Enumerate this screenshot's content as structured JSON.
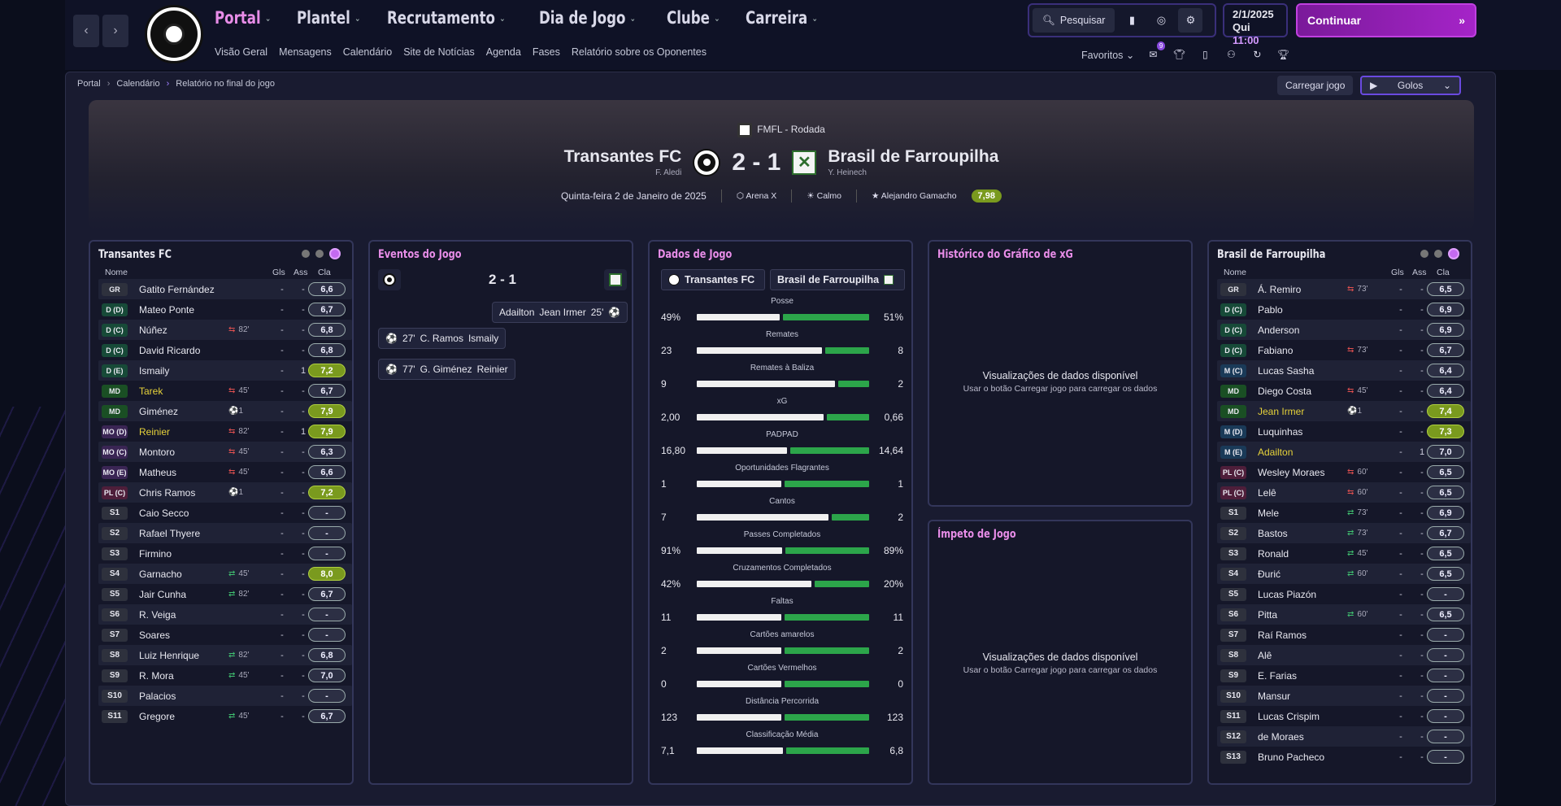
{
  "nav": {
    "main": [
      {
        "label": "Portal",
        "active": true
      },
      {
        "label": "Plantel",
        "active": false
      },
      {
        "label": "Recrutamento",
        "active": false
      },
      {
        "label": "Dia de Jogo",
        "active": false
      },
      {
        "label": "Clube",
        "active": false
      },
      {
        "label": "Carreira",
        "active": false
      }
    ],
    "sub": [
      "Visão Geral",
      "Mensagens",
      "Calendário",
      "Site de Notícias",
      "Agenda",
      "Fases",
      "Relatório sobre os Oponentes"
    ],
    "search_label": "Pesquisar",
    "date": "2/1/2025",
    "weekday": "Qui",
    "time": "11:00",
    "continue_label": "Continuar",
    "favorites_label": "Favoritos",
    "msg_badge": "9"
  },
  "breadcrumb": [
    "Portal",
    "Calendário",
    "Relatório no final do jogo"
  ],
  "actions": {
    "load_game": "Carregar jogo",
    "highlights": "Golos"
  },
  "match": {
    "competition": "FMFL - Rodada",
    "home": "Transantes FC",
    "home_manager": "F. Aledi",
    "away": "Brasil de Farroupilha",
    "away_manager": "Y. Heinech",
    "score": "2 - 1",
    "date": "Quinta-feira 2 de Janeiro de 2025",
    "stadium": "Arena X",
    "weather": "Calmo",
    "referee": "Alejandro Gamacho",
    "referee_rating": "7,98"
  },
  "home_panel": {
    "title": "Transantes FC",
    "headers": {
      "name": "Nome",
      "goals": "Gls",
      "assists": "Ass",
      "rating": "Cla"
    },
    "players": [
      {
        "pos": "GR",
        "cls": "gk",
        "name": "Gatito Fernández",
        "sub": "",
        "gl": "-",
        "as": "-",
        "cl": "6,6",
        "hi": false
      },
      {
        "pos": "D (D)",
        "cls": "d",
        "name": "Mateo Ponte",
        "sub": "",
        "gl": "-",
        "as": "-",
        "cl": "6,7",
        "hi": false
      },
      {
        "pos": "D (C)",
        "cls": "d",
        "name": "Núñez",
        "sub": "82'",
        "subdir": "out",
        "gl": "-",
        "as": "-",
        "cl": "6,8",
        "hi": false
      },
      {
        "pos": "D (C)",
        "cls": "d",
        "name": "David Ricardo",
        "sub": "",
        "gl": "-",
        "as": "-",
        "cl": "6,8",
        "hi": false
      },
      {
        "pos": "D (E)",
        "cls": "d",
        "name": "Ismaily",
        "sub": "",
        "gl": "-",
        "as": "1",
        "cl": "7,2",
        "hi": true
      },
      {
        "pos": "MD",
        "cls": "m",
        "name": "Tarek",
        "yellow": true,
        "sub": "45'",
        "subdir": "out",
        "gl": "-",
        "as": "-",
        "cl": "6,7",
        "hi": false
      },
      {
        "pos": "MD",
        "cls": "m",
        "name": "Giménez",
        "sub": "⚽1",
        "gl": "-",
        "as": "-",
        "cl": "7,9",
        "hi": true
      },
      {
        "pos": "MO (D)",
        "cls": "mo",
        "name": "Reinier",
        "yellow": true,
        "sub": "82'",
        "subdir": "out",
        "gl": "-",
        "as": "1",
        "cl": "7,9",
        "hi": true
      },
      {
        "pos": "MO (C)",
        "cls": "mo",
        "name": "Montoro",
        "sub": "45'",
        "subdir": "out",
        "gl": "-",
        "as": "-",
        "cl": "6,3",
        "hi": false
      },
      {
        "pos": "MO (E)",
        "cls": "mo",
        "name": "Matheus",
        "sub": "45'",
        "subdir": "out",
        "gl": "-",
        "as": "-",
        "cl": "6,6",
        "hi": false
      },
      {
        "pos": "PL (C)",
        "cls": "pl",
        "name": "Chris Ramos",
        "sub": "⚽1",
        "gl": "-",
        "as": "-",
        "cl": "7,2",
        "hi": true
      },
      {
        "pos": "S1",
        "cls": "s",
        "name": "Caio Secco",
        "sub": "",
        "gl": "-",
        "as": "-",
        "cl": "-",
        "hi": false
      },
      {
        "pos": "S2",
        "cls": "s",
        "name": "Rafael Thyere",
        "sub": "",
        "gl": "-",
        "as": "-",
        "cl": "-",
        "hi": false
      },
      {
        "pos": "S3",
        "cls": "s",
        "name": "Firmino",
        "sub": "",
        "gl": "-",
        "as": "-",
        "cl": "-",
        "hi": false
      },
      {
        "pos": "S4",
        "cls": "s",
        "name": "Garnacho",
        "sub": "45'",
        "subdir": "in",
        "gl": "-",
        "as": "-",
        "cl": "8,0",
        "hi": true
      },
      {
        "pos": "S5",
        "cls": "s",
        "name": "Jair Cunha",
        "sub": "82'",
        "subdir": "in",
        "gl": "-",
        "as": "-",
        "cl": "6,7",
        "hi": false
      },
      {
        "pos": "S6",
        "cls": "s",
        "name": "R. Veiga",
        "sub": "",
        "gl": "-",
        "as": "-",
        "cl": "-",
        "hi": false
      },
      {
        "pos": "S7",
        "cls": "s",
        "name": "Soares",
        "sub": "",
        "gl": "-",
        "as": "-",
        "cl": "-",
        "hi": false
      },
      {
        "pos": "S8",
        "cls": "s",
        "name": "Luiz Henrique",
        "sub": "82'",
        "subdir": "in",
        "gl": "-",
        "as": "-",
        "cl": "6,8",
        "hi": false
      },
      {
        "pos": "S9",
        "cls": "s",
        "name": "R. Mora",
        "sub": "45'",
        "subdir": "in",
        "gl": "-",
        "as": "-",
        "cl": "7,0",
        "hi": false
      },
      {
        "pos": "S10",
        "cls": "s",
        "name": "Palacios",
        "sub": "",
        "gl": "-",
        "as": "-",
        "cl": "-",
        "hi": false
      },
      {
        "pos": "S11",
        "cls": "s",
        "name": "Gregore",
        "sub": "45'",
        "subdir": "in",
        "gl": "-",
        "as": "-",
        "cl": "6,7",
        "hi": false
      }
    ]
  },
  "events": {
    "title": "Eventos do Jogo",
    "score": "2 - 1",
    "items": [
      {
        "side": "away",
        "minute": "25'",
        "text": "Adailton",
        "assist": "Jean Irmer"
      },
      {
        "side": "home",
        "minute": "27'",
        "text": "C. Ramos",
        "assist": "Ismaily"
      },
      {
        "side": "home",
        "minute": "77'",
        "text": "G. Giménez",
        "assist": "Reinier"
      }
    ]
  },
  "stats": {
    "title": "Dados de Jogo",
    "home": "Transantes FC",
    "away": "Brasil de Farroupilha",
    "rows": [
      {
        "label": "Posse",
        "h": "49%",
        "a": "51%",
        "hv": 49,
        "av": 51
      },
      {
        "label": "Remates",
        "h": "23",
        "a": "8",
        "hv": 23,
        "av": 8
      },
      {
        "label": "Remates à Baliza",
        "h": "9",
        "a": "2",
        "hv": 9,
        "av": 2
      },
      {
        "label": "xG",
        "h": "2,00",
        "a": "0,66",
        "hv": 2.0,
        "av": 0.66
      },
      {
        "label": "PADPAD",
        "h": "16,80",
        "a": "14,64",
        "hv": 16.8,
        "av": 14.64
      },
      {
        "label": "Oportunidades Flagrantes",
        "h": "1",
        "a": "1",
        "hv": 1,
        "av": 1
      },
      {
        "label": "Cantos",
        "h": "7",
        "a": "2",
        "hv": 7,
        "av": 2
      },
      {
        "label": "Passes Completados",
        "h": "91%",
        "a": "89%",
        "hv": 91,
        "av": 89
      },
      {
        "label": "Cruzamentos Completados",
        "h": "42%",
        "a": "20%",
        "hv": 42,
        "av": 20
      },
      {
        "label": "Faltas",
        "h": "11",
        "a": "11",
        "hv": 11,
        "av": 11
      },
      {
        "label": "Cartões amarelos",
        "h": "2",
        "a": "2",
        "hv": 2,
        "av": 2
      },
      {
        "label": "Cartões Vermelhos",
        "h": "0",
        "a": "0",
        "hv": 0,
        "av": 0
      },
      {
        "label": "Distância Percorrida",
        "h": "123",
        "a": "123",
        "hv": 123,
        "av": 123
      },
      {
        "label": "Classificação Média",
        "h": "7,1",
        "a": "6,8",
        "hv": 7.1,
        "av": 6.8
      }
    ]
  },
  "xg": {
    "title": "Histórico do Gráfico de xG",
    "msg": "Visualizações de dados disponível",
    "hint": "Usar o botão Carregar jogo para carregar os dados"
  },
  "momentum": {
    "title": "Ímpeto de Jogo",
    "msg": "Visualizações de dados disponível",
    "hint": "Usar o botão Carregar jogo para carregar os dados"
  },
  "away_panel": {
    "title": "Brasil de Farroupilha",
    "headers": {
      "name": "Nome",
      "goals": "Gls",
      "assists": "Ass",
      "rating": "Cla"
    },
    "players": [
      {
        "pos": "GR",
        "cls": "gk",
        "name": "Á. Remiro",
        "sub": "73'",
        "subdir": "out",
        "gl": "-",
        "as": "-",
        "cl": "6,5",
        "hi": false
      },
      {
        "pos": "D (C)",
        "cls": "d",
        "name": "Pablo",
        "sub": "",
        "gl": "-",
        "as": "-",
        "cl": "6,9",
        "hi": false
      },
      {
        "pos": "D (C)",
        "cls": "d",
        "name": "Anderson",
        "sub": "",
        "gl": "-",
        "as": "-",
        "cl": "6,9",
        "hi": false
      },
      {
        "pos": "D (C)",
        "cls": "d",
        "name": "Fabiano",
        "sub": "73'",
        "subdir": "out",
        "gl": "-",
        "as": "-",
        "cl": "6,7",
        "hi": false
      },
      {
        "pos": "M (C)",
        "cls": "mc",
        "name": "Lucas Sasha",
        "sub": "",
        "gl": "-",
        "as": "-",
        "cl": "6,4",
        "hi": false
      },
      {
        "pos": "MD",
        "cls": "m",
        "name": "Diego Costa",
        "sub": "45'",
        "subdir": "out",
        "gl": "-",
        "as": "-",
        "cl": "6,4",
        "hi": false
      },
      {
        "pos": "MD",
        "cls": "m",
        "name": "Jean Irmer",
        "yellow": true,
        "sub": "⚽1",
        "gl": "-",
        "as": "-",
        "cl": "7,4",
        "hi": true
      },
      {
        "pos": "M (D)",
        "cls": "mc",
        "name": "Luquinhas",
        "sub": "",
        "gl": "-",
        "as": "-",
        "cl": "7,3",
        "hi": true
      },
      {
        "pos": "M (E)",
        "cls": "mc",
        "name": "Adailton",
        "yellow": true,
        "sub": "",
        "gl": "-",
        "as": "1",
        "cl": "7,0",
        "hi": false
      },
      {
        "pos": "PL (C)",
        "cls": "pl",
        "name": "Wesley Moraes",
        "sub": "60'",
        "subdir": "out",
        "gl": "-",
        "as": "-",
        "cl": "6,5",
        "hi": false
      },
      {
        "pos": "PL (C)",
        "cls": "pl",
        "name": "Lelê",
        "sub": "60'",
        "subdir": "out",
        "gl": "-",
        "as": "-",
        "cl": "6,5",
        "hi": false
      },
      {
        "pos": "S1",
        "cls": "s",
        "name": "Mele",
        "sub": "73'",
        "subdir": "in",
        "gl": "-",
        "as": "-",
        "cl": "6,9",
        "hi": false
      },
      {
        "pos": "S2",
        "cls": "s",
        "name": "Bastos",
        "sub": "73'",
        "subdir": "in",
        "gl": "-",
        "as": "-",
        "cl": "6,7",
        "hi": false
      },
      {
        "pos": "S3",
        "cls": "s",
        "name": "Ronald",
        "sub": "45'",
        "subdir": "in",
        "gl": "-",
        "as": "-",
        "cl": "6,5",
        "hi": false
      },
      {
        "pos": "S4",
        "cls": "s",
        "name": "Đurić",
        "sub": "60'",
        "subdir": "in",
        "gl": "-",
        "as": "-",
        "cl": "6,5",
        "hi": false
      },
      {
        "pos": "S5",
        "cls": "s",
        "name": "Lucas Piazón",
        "sub": "",
        "gl": "-",
        "as": "-",
        "cl": "-",
        "hi": false
      },
      {
        "pos": "S6",
        "cls": "s",
        "name": "Pitta",
        "sub": "60'",
        "subdir": "in",
        "gl": "-",
        "as": "-",
        "cl": "6,5",
        "hi": false
      },
      {
        "pos": "S7",
        "cls": "s",
        "name": "Raí Ramos",
        "sub": "",
        "gl": "-",
        "as": "-",
        "cl": "-",
        "hi": false
      },
      {
        "pos": "S8",
        "cls": "s",
        "name": "Alê",
        "sub": "",
        "gl": "-",
        "as": "-",
        "cl": "-",
        "hi": false
      },
      {
        "pos": "S9",
        "cls": "s",
        "name": "E. Farias",
        "sub": "",
        "gl": "-",
        "as": "-",
        "cl": "-",
        "hi": false
      },
      {
        "pos": "S10",
        "cls": "s",
        "name": "Mansur",
        "sub": "",
        "gl": "-",
        "as": "-",
        "cl": "-",
        "hi": false
      },
      {
        "pos": "S11",
        "cls": "s",
        "name": "Lucas Crispim",
        "sub": "",
        "gl": "-",
        "as": "-",
        "cl": "-",
        "hi": false
      },
      {
        "pos": "S12",
        "cls": "s",
        "name": "de Moraes",
        "sub": "",
        "gl": "-",
        "as": "-",
        "cl": "-",
        "hi": false
      },
      {
        "pos": "S13",
        "cls": "s",
        "name": "Bruno Pacheco",
        "sub": "",
        "gl": "-",
        "as": "-",
        "cl": "-",
        "hi": false
      }
    ]
  }
}
